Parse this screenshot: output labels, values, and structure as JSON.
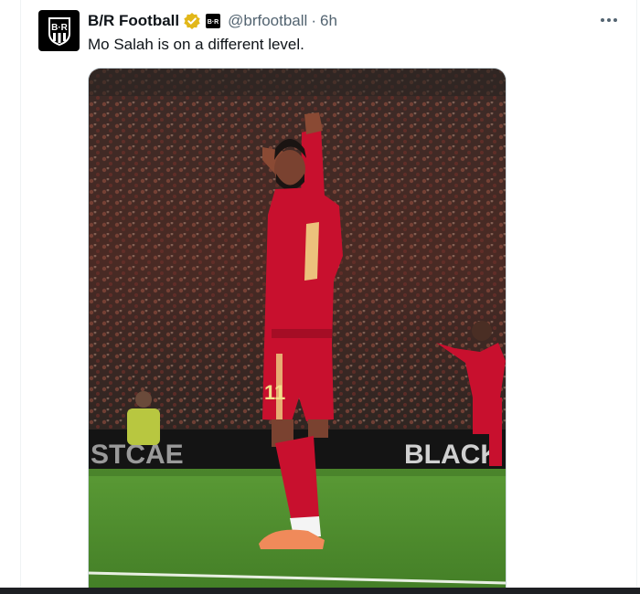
{
  "tweet": {
    "display_name": "B/R Football",
    "handle": "@brfootball",
    "separator": "·",
    "time": "6h",
    "text": "Mo Salah is on a different level.",
    "avatar_monogram": "B·R",
    "affiliate_badge": "B·R"
  },
  "media": {
    "board_left": "STCAE",
    "board_right": "BLACK",
    "shirt_number": "11"
  },
  "icons": {
    "verified": "verified-badge-icon",
    "more": "more-horizontal-icon"
  },
  "colors": {
    "text_primary": "#0f1419",
    "text_secondary": "#536471",
    "verified_gold": "#e2b719",
    "kit_red": "#c8102e",
    "pitch_green": "#4f8f2f"
  }
}
